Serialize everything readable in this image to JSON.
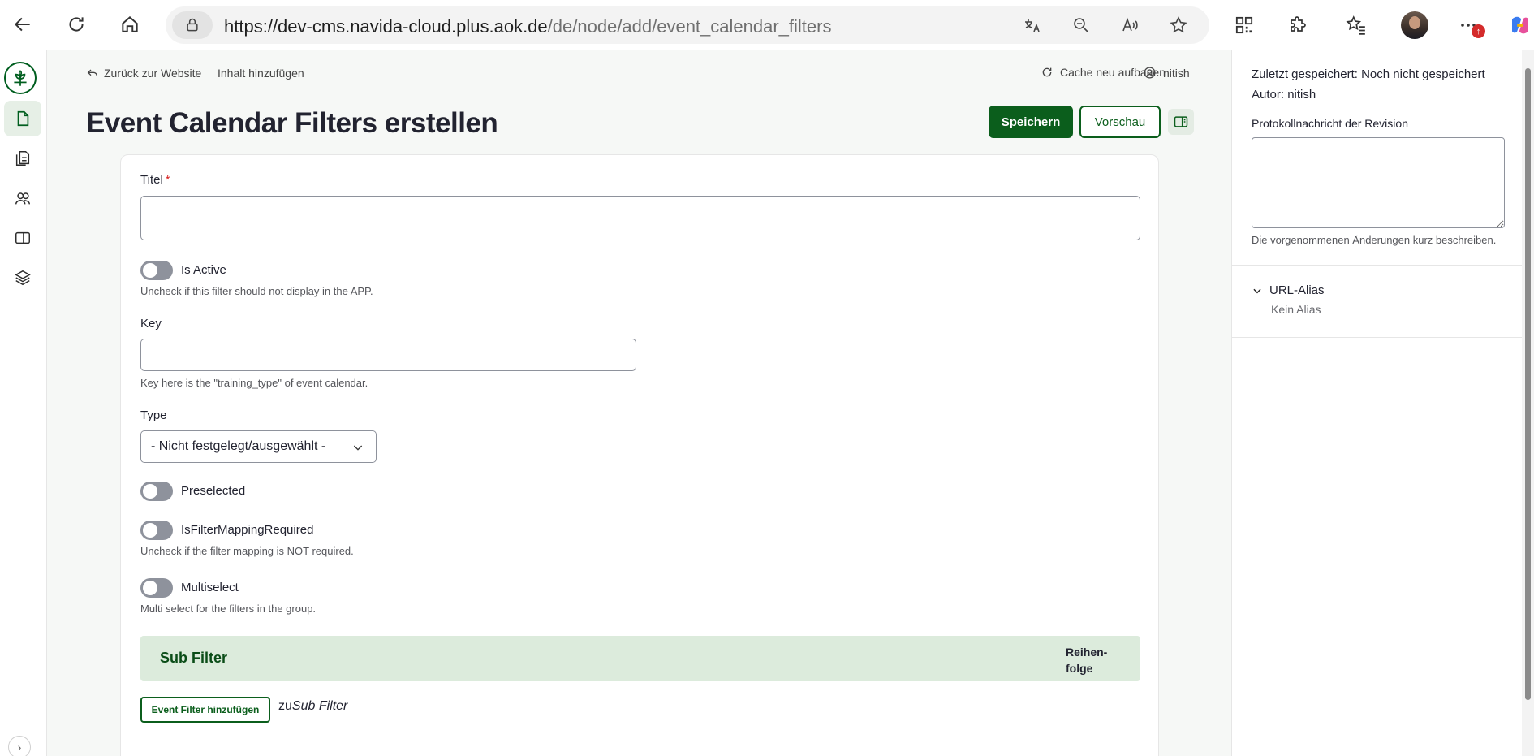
{
  "browser": {
    "url_host": "https://dev-cms.navida-cloud.plus.aok.de",
    "url_path": "/de/node/add/event_calendar_filters",
    "notification_count": "↑"
  },
  "rail": {
    "items": [
      "logo-icon",
      "document-icon",
      "documents-icon",
      "people-icon",
      "layout-icon",
      "layers-icon"
    ]
  },
  "topbar": {
    "back_label": "Zurück zur Website",
    "add_content_label": "Inhalt hinzufügen",
    "cache_label": "Cache neu aufbauen",
    "user_label": "nitish"
  },
  "page": {
    "title": "Event Calendar Filters erstellen",
    "save_label": "Speichern",
    "preview_label": "Vorschau"
  },
  "form": {
    "title_label": "Titel",
    "title_required_mark": "*",
    "title_value": "",
    "is_active_label": "Is Active",
    "is_active_desc": "Uncheck if this filter should not display in the APP.",
    "is_active_on": false,
    "key_label": "Key",
    "key_value": "",
    "key_desc": "Key here is the \"training_type\" of event calendar.",
    "type_label": "Type",
    "type_value": "- Nicht festgelegt/ausgewählt -",
    "preselected_label": "Preselected",
    "preselected_on": false,
    "mapping_label": "IsFilterMappingRequired",
    "mapping_desc": "Uncheck if the filter mapping is NOT required.",
    "mapping_on": false,
    "multiselect_label": "Multiselect",
    "multiselect_desc": "Multi select for the filters in the group.",
    "multiselect_on": false
  },
  "sub_filter": {
    "title": "Sub Filter",
    "order_label": "Reihen-folge",
    "add_button": "Event Filter hinzufügen",
    "to_prefix": "zu",
    "to_target": "Sub Filter"
  },
  "sidebar": {
    "last_saved_key": "Zuletzt gespeichert:",
    "last_saved_value": "Noch nicht gespeichert",
    "author_key": "Autor:",
    "author_value": "nitish",
    "revision_label": "Protokollnachricht der Revision",
    "revision_value": "",
    "revision_help": "Die vorgenommenen Änderungen kurz beschreiben.",
    "alias_label": "URL-Alias",
    "alias_value": "Kein Alias"
  },
  "colors": {
    "brand_green": "#0b5e1c",
    "panel_green": "#dcebdc",
    "required_red": "#d72222"
  }
}
